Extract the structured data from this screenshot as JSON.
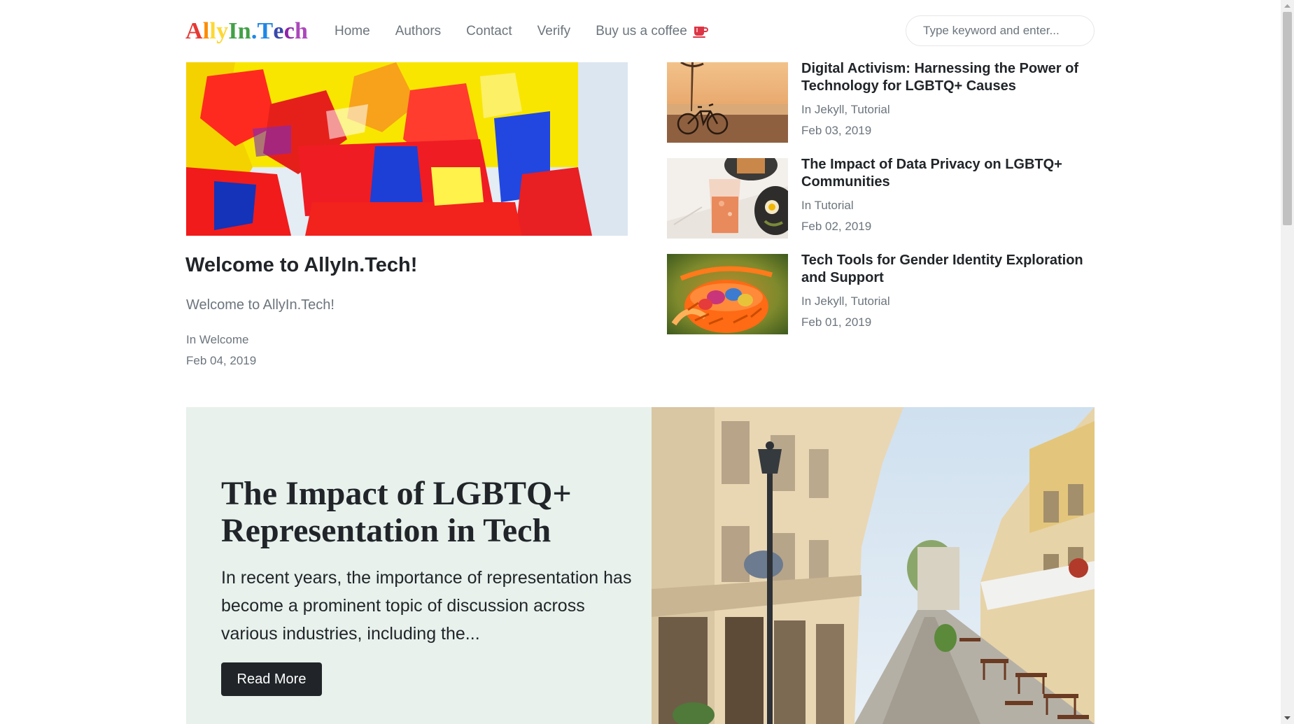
{
  "site": {
    "logo_chars": [
      {
        "c": "A",
        "color": "#e53935"
      },
      {
        "c": "l",
        "color": "#fb8c00"
      },
      {
        "c": "l",
        "color": "#fdd835"
      },
      {
        "c": "y",
        "color": "#fdd835"
      },
      {
        "c": "I",
        "color": "#43a047"
      },
      {
        "c": "n",
        "color": "#43a047"
      },
      {
        "c": ".",
        "color": "#1e88e5"
      },
      {
        "c": "T",
        "color": "#1e88e5"
      },
      {
        "c": "e",
        "color": "#3949ab"
      },
      {
        "c": "c",
        "color": "#8e24aa"
      },
      {
        "c": "h",
        "color": "#ab47bc"
      }
    ]
  },
  "nav": {
    "items": [
      {
        "label": "Home"
      },
      {
        "label": "Authors"
      },
      {
        "label": "Contact"
      },
      {
        "label": "Verify"
      },
      {
        "label": "Buy us a coffee",
        "icon": "coffee-cup-icon",
        "icon_color": "#dc3545"
      }
    ]
  },
  "search": {
    "placeholder": "Type keyword and enter..."
  },
  "featured": {
    "image": "abstract-paint-image",
    "title": "Welcome to AllyIn.Tech!",
    "excerpt": "Welcome to AllyIn.Tech!",
    "category_prefix": "In ",
    "category": "Welcome",
    "date": "Feb 04, 2019"
  },
  "side_posts": [
    {
      "image": "bicycle-beach-image",
      "title": "Digital Activism: Harnessing the Power of Technology for LGBTQ+ Causes",
      "category_prefix": "In ",
      "categories": [
        "Jekyll",
        "Tutorial"
      ],
      "date": "Feb 03, 2019"
    },
    {
      "image": "table-drinks-image",
      "title": "The Impact of Data Privacy on LGBTQ+ Communities",
      "category_prefix": "In ",
      "categories": [
        "Tutorial"
      ],
      "date": "Feb 02, 2019"
    },
    {
      "image": "easter-basket-image",
      "title": "Tech Tools for Gender Identity Exploration and Support",
      "category_prefix": "In ",
      "categories": [
        "Jekyll",
        "Tutorial"
      ],
      "date": "Feb 01, 2019"
    }
  ],
  "hero": {
    "title": "The Impact of LGBTQ+ Representation in Tech",
    "excerpt": "In recent years, the importance of representation has become a prominent topic of discussion across various industries, including the...",
    "button_label": "Read More",
    "image": "old-town-street-image",
    "panel_color": "#e8f1ec"
  }
}
